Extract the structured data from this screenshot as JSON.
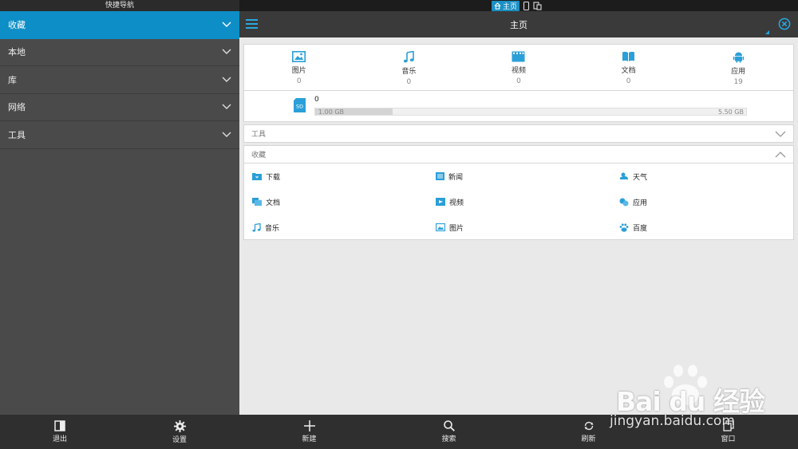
{
  "sidebar": {
    "title": "快捷导航",
    "items": [
      {
        "label": "收藏",
        "active": true
      },
      {
        "label": "本地"
      },
      {
        "label": "库"
      },
      {
        "label": "网络"
      },
      {
        "label": "工具"
      }
    ],
    "bottom": [
      {
        "label": "退出",
        "icon": "exit-icon"
      },
      {
        "label": "设置",
        "icon": "gear-icon"
      }
    ]
  },
  "status": {
    "home_label": "主页",
    "icons": [
      "home-icon",
      "phone-icon",
      "devices-icon"
    ]
  },
  "topbar": {
    "title": "主页"
  },
  "categories": [
    {
      "label": "图片",
      "count": "0",
      "icon": "image-icon"
    },
    {
      "label": "音乐",
      "count": "0",
      "icon": "music-icon"
    },
    {
      "label": "视频",
      "count": "0",
      "icon": "video-icon"
    },
    {
      "label": "文档",
      "count": "0",
      "icon": "book-icon"
    },
    {
      "label": "应用",
      "count": "19",
      "icon": "android-icon"
    }
  ],
  "storage": {
    "name": "0",
    "badge": "SD",
    "used": "1.00 GB",
    "total": "5.50 GB",
    "used_fraction": 0.18
  },
  "sections": {
    "tools": "工具",
    "favorites": "收藏"
  },
  "favorites": [
    {
      "label": "下载",
      "icon": "download-folder-icon"
    },
    {
      "label": "新闻",
      "icon": "news-icon"
    },
    {
      "label": "天气",
      "icon": "weather-icon"
    },
    {
      "label": "文档",
      "icon": "document-icon"
    },
    {
      "label": "视频",
      "icon": "video-icon"
    },
    {
      "label": "应用",
      "icon": "apps-icon"
    },
    {
      "label": "音乐",
      "icon": "music-icon"
    },
    {
      "label": "图片",
      "icon": "image-icon"
    },
    {
      "label": "百度",
      "icon": "baidu-icon"
    }
  ],
  "bottom_bar": [
    {
      "label": "新建",
      "icon": "plus-icon"
    },
    {
      "label": "搜索",
      "icon": "search-icon"
    },
    {
      "label": "刷新",
      "icon": "refresh-icon"
    },
    {
      "label": "窗口",
      "icon": "window-icon"
    }
  ],
  "watermark": {
    "brand": "Bai du 经验",
    "url": "jingyan.baidu.com"
  },
  "colors": {
    "accent": "#0e8ec6",
    "icon_blue": "#2a9fd8",
    "sidebar": "#4a4a4a",
    "bar": "#2f2f2f"
  }
}
